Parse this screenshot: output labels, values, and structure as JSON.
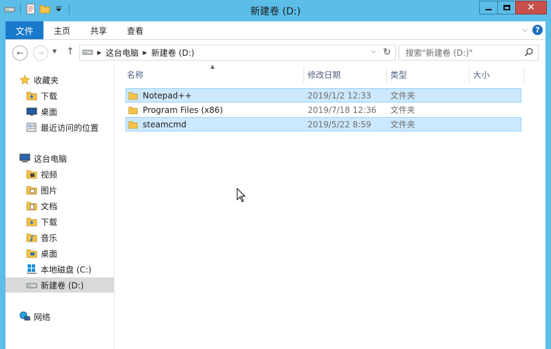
{
  "window": {
    "title": "新建卷 (D:)"
  },
  "ribbon": {
    "file_tab": "文件",
    "tabs": [
      "主页",
      "共享",
      "查看"
    ],
    "help": "?"
  },
  "address": {
    "breadcrumbs": [
      "这台电脑",
      "新建卷 (D:)"
    ],
    "search_placeholder": "搜索\"新建卷 (D:)\""
  },
  "nav": {
    "favorites_label": "收藏夹",
    "favorites": [
      "下载",
      "桌面",
      "最近访问的位置"
    ],
    "this_pc_label": "这台电脑",
    "this_pc": [
      "视频",
      "图片",
      "文档",
      "下载",
      "音乐",
      "桌面",
      "本地磁盘 (C:)",
      "新建卷 (D:)"
    ],
    "network_label": "网络"
  },
  "columns": [
    "名称",
    "修改日期",
    "类型",
    "大小"
  ],
  "files": [
    {
      "name": "Notepad++",
      "date": "2019/1/2 12:33",
      "type": "文件夹",
      "selected": true
    },
    {
      "name": "Program Files (x86)",
      "date": "2019/7/18 12:36",
      "type": "文件夹",
      "selected": false
    },
    {
      "name": "steamcmd",
      "date": "2019/5/22 8:59",
      "type": "文件夹",
      "selected": true
    }
  ],
  "colors": {
    "titlebar": "#5bbde8",
    "accent": "#1979ca",
    "selection": "#cce8ff",
    "selection_border": "#99d1ff",
    "close_button": "#c7504b"
  }
}
